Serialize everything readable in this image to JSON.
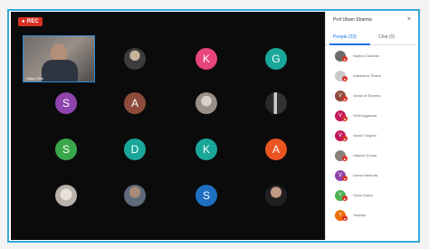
{
  "recording": {
    "label": "● REC"
  },
  "self_video": {
    "name": "Uttam Sha"
  },
  "grid": [
    {
      "id": "p1",
      "letter": "",
      "type": "photo-a"
    },
    {
      "id": "p2",
      "letter": "K",
      "color": "#e8457a"
    },
    {
      "id": "p3",
      "letter": "G",
      "color": "#1aa79a"
    },
    {
      "id": "p4",
      "letter": "S",
      "color": "#8e44ad"
    },
    {
      "id": "p5",
      "letter": "A",
      "color": "#8e4b3b"
    },
    {
      "id": "p6",
      "letter": "",
      "type": "photo-b"
    },
    {
      "id": "p7",
      "letter": "",
      "type": "photo-c"
    },
    {
      "id": "p8",
      "letter": "S",
      "color": "#3aa64a"
    },
    {
      "id": "p9",
      "letter": "D",
      "color": "#1aa79a"
    },
    {
      "id": "p10",
      "letter": "K",
      "color": "#1aa79a"
    },
    {
      "id": "p11",
      "letter": "A",
      "color": "#e95420"
    },
    {
      "id": "p12",
      "letter": "",
      "type": "photo-d"
    },
    {
      "id": "p13",
      "letter": "",
      "type": "photo-e"
    },
    {
      "id": "p14",
      "letter": "S",
      "color": "#1e6fc1"
    },
    {
      "id": "p15",
      "letter": "",
      "type": "photo-f"
    }
  ],
  "panel": {
    "title": "Prof Uttam Sharma",
    "close": "×",
    "tabs": {
      "people": "People (23)",
      "chat": "Chat (0)"
    },
    "people": [
      {
        "initial": "",
        "color": "#6b6b6b",
        "name": "Nayha Chauhan"
      },
      {
        "initial": "",
        "color": "#c9c9c9",
        "name": "Aakansha Thakur"
      },
      {
        "initial": "V",
        "color": "#8e4b3b",
        "name": "Vansh M Sharma"
      },
      {
        "initial": "V",
        "color": "#c2185b",
        "name": "Vidhi Aggarwal"
      },
      {
        "initial": "V",
        "color": "#c2185b",
        "name": "Vansh Singhal"
      },
      {
        "initial": "",
        "color": "#8a7f78",
        "name": "Utkarsh Kumar"
      },
      {
        "initial": "V",
        "color": "#8e44ad",
        "name": "Veena Mehrota"
      },
      {
        "initial": "Y",
        "color": "#4caf50",
        "name": "Yashi Gupta"
      },
      {
        "initial": "Y",
        "color": "#ef6c00",
        "name": "Yashika"
      }
    ]
  }
}
